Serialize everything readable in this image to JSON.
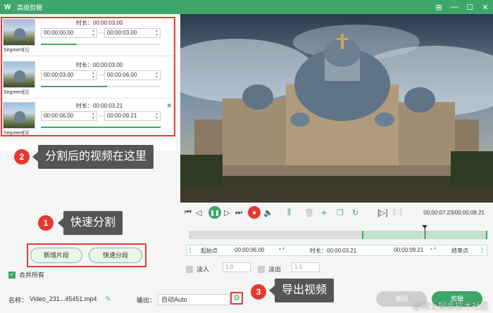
{
  "window": {
    "logo": "W",
    "title": "高级剪辑",
    "controls": [
      "⊞",
      "—",
      "☐",
      "✕"
    ]
  },
  "segments": [
    {
      "label": "Segment[1]",
      "duration": "时长：00:00:03.00",
      "start": "00:00:00.00",
      "end": "00:00:03.00",
      "progress": 0.3
    },
    {
      "label": "Segment[2]",
      "duration": "时长：00:00:03.00",
      "start": "00:00:03.00",
      "end": "00:00:06.00",
      "progress": 0.55
    },
    {
      "label": "Segment[3]",
      "duration": "时长：00:00:03.21",
      "start": "00:00:06.00",
      "end": "00:00:09.21",
      "progress": 1.0
    }
  ],
  "callouts": {
    "c1": {
      "num": "1",
      "text": "快速分割"
    },
    "c2": {
      "num": "2",
      "text": "分割后的视频在这里"
    },
    "c3": {
      "num": "3",
      "text": "导出视频"
    }
  },
  "buttons": {
    "add_segment": "新增片段",
    "quick_split": "快速分段",
    "back": "返回",
    "edit": "剪辑"
  },
  "merge_all": "合并所有",
  "playback": {
    "timecode": "00:00:07.23/00:00:09.21",
    "selection_start": 0.58,
    "playhead": 0.79
  },
  "range": {
    "start_label": "起始点",
    "start": "00:00:06.00",
    "duration": "时长：00:00:03.21",
    "end": "00:00:09.21",
    "end_label": "结束点"
  },
  "fade": {
    "in_label": "淡入",
    "in_value": "1.0",
    "out_label": "淡出",
    "out_value": "1.0"
  },
  "bottom": {
    "name_label": "名称：",
    "name_value": "Video_231...45451.mp4",
    "output_label": "输出：",
    "output_value": "自动Auto"
  },
  "watermark": "@稀土掘金技术社区",
  "colors": {
    "accent": "#3fa66a",
    "callout": "#e5392f",
    "highlight_box": "#e03b3b"
  }
}
